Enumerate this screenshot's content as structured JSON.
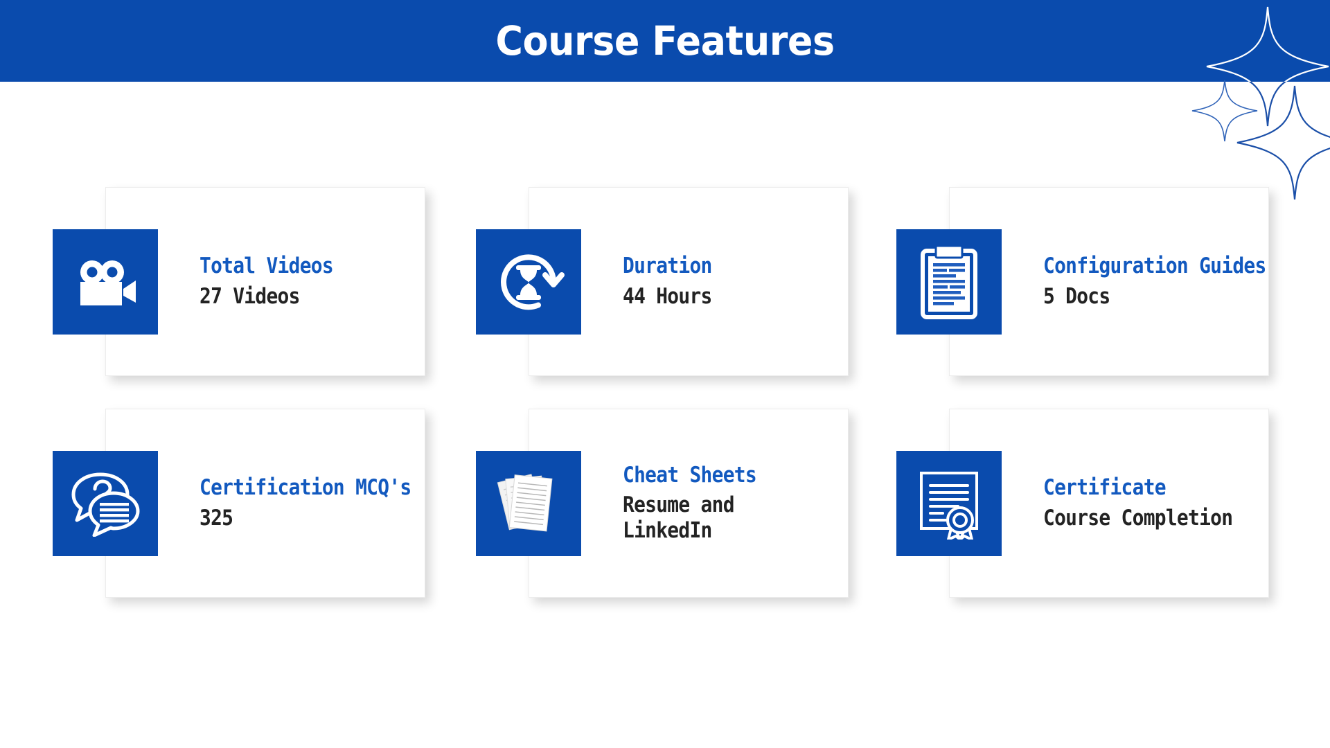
{
  "header": {
    "title": "Course Features",
    "background_color": "#0A4BAD",
    "text_color": "#FFFFFF"
  },
  "theme": {
    "brand_blue": "#0A4BAD",
    "title_blue": "#1259BF",
    "value_dark": "#232323",
    "card_background": "#FFFFFF",
    "page_background": "#FFFFFF"
  },
  "decorations": [
    {
      "name": "sparkle-large-top",
      "icon": "four-point-star-icon"
    },
    {
      "name": "sparkle-small-left",
      "icon": "four-point-star-icon"
    },
    {
      "name": "sparkle-medium-bottom",
      "icon": "four-point-star-icon"
    }
  ],
  "cards": [
    {
      "icon": "video-camera-icon",
      "title": "Total Videos",
      "value": "27 Videos",
      "value_nowrap": true
    },
    {
      "icon": "hourglass-refresh-icon",
      "title": "Duration",
      "value": "44 Hours",
      "value_nowrap": true
    },
    {
      "icon": "clipboard-document-icon",
      "title": "Configuration Guides",
      "value": "5 Docs",
      "value_nowrap": true
    },
    {
      "icon": "chat-bubbles-question-icon",
      "title": "Certification MCQ's",
      "value": "325",
      "value_nowrap": true
    },
    {
      "icon": "stacked-papers-icon",
      "title": "Cheat Sheets",
      "value": "Resume and LinkedIn",
      "value_nowrap": false
    },
    {
      "icon": "certificate-ribbon-icon",
      "title": "Certificate",
      "value": "Course Completion",
      "value_nowrap": true
    }
  ]
}
